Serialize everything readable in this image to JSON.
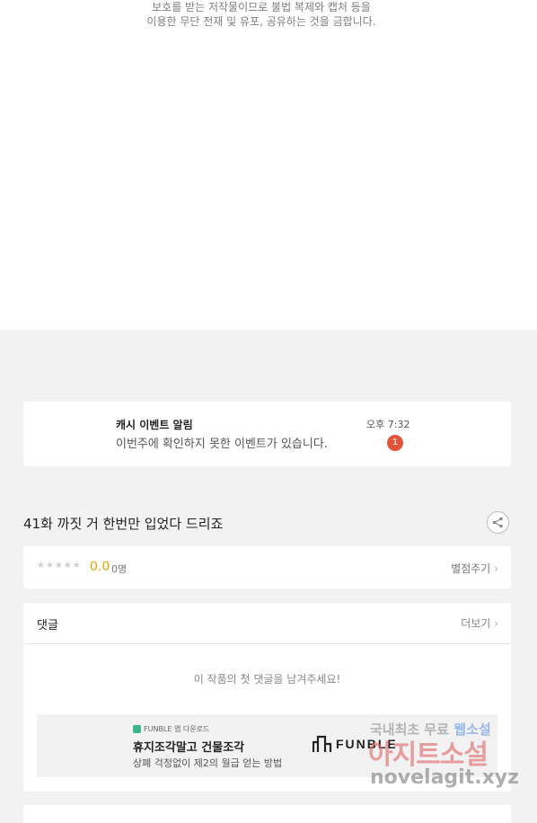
{
  "notice": {
    "line1": "보호를 받는 저작물이므로 불법 복제와 캡처 등을",
    "line2": "이용한 무단 전재 및 유포, 공유하는 것을 금합니다."
  },
  "push": {
    "title": "캐시 이벤트 알림",
    "time": "오후 7:32",
    "message": "이번주에 확인하지 못한 이벤트가 있습니다.",
    "badge": "1"
  },
  "episode": {
    "title": "41화 까짓 거 한번만 입었다 드리죠"
  },
  "rating": {
    "stars": "★★★★★",
    "score": "0.0",
    "count": "0명",
    "rate_label": "별점주기"
  },
  "comments": {
    "header": "댓글",
    "more": "더보기",
    "empty": "이 작품의 첫 댓글을 남겨주세요!"
  },
  "ad": {
    "small": "FUNBLE 앱 다운로드",
    "title": "휴지조각말고 건물조각",
    "subtitle": "상폐 걱정없이 제2의 월급 얻는 방법",
    "logo": "FUNBLE"
  },
  "watermark": {
    "line1_a": "국내최초 무료",
    "line1_b": "웹소설",
    "line2": "아지트소설",
    "line3": "novelagit.xyz"
  },
  "colors": {
    "badge": "#e2533a",
    "score": "#e0a800",
    "ad_accent": "#39b58b"
  }
}
